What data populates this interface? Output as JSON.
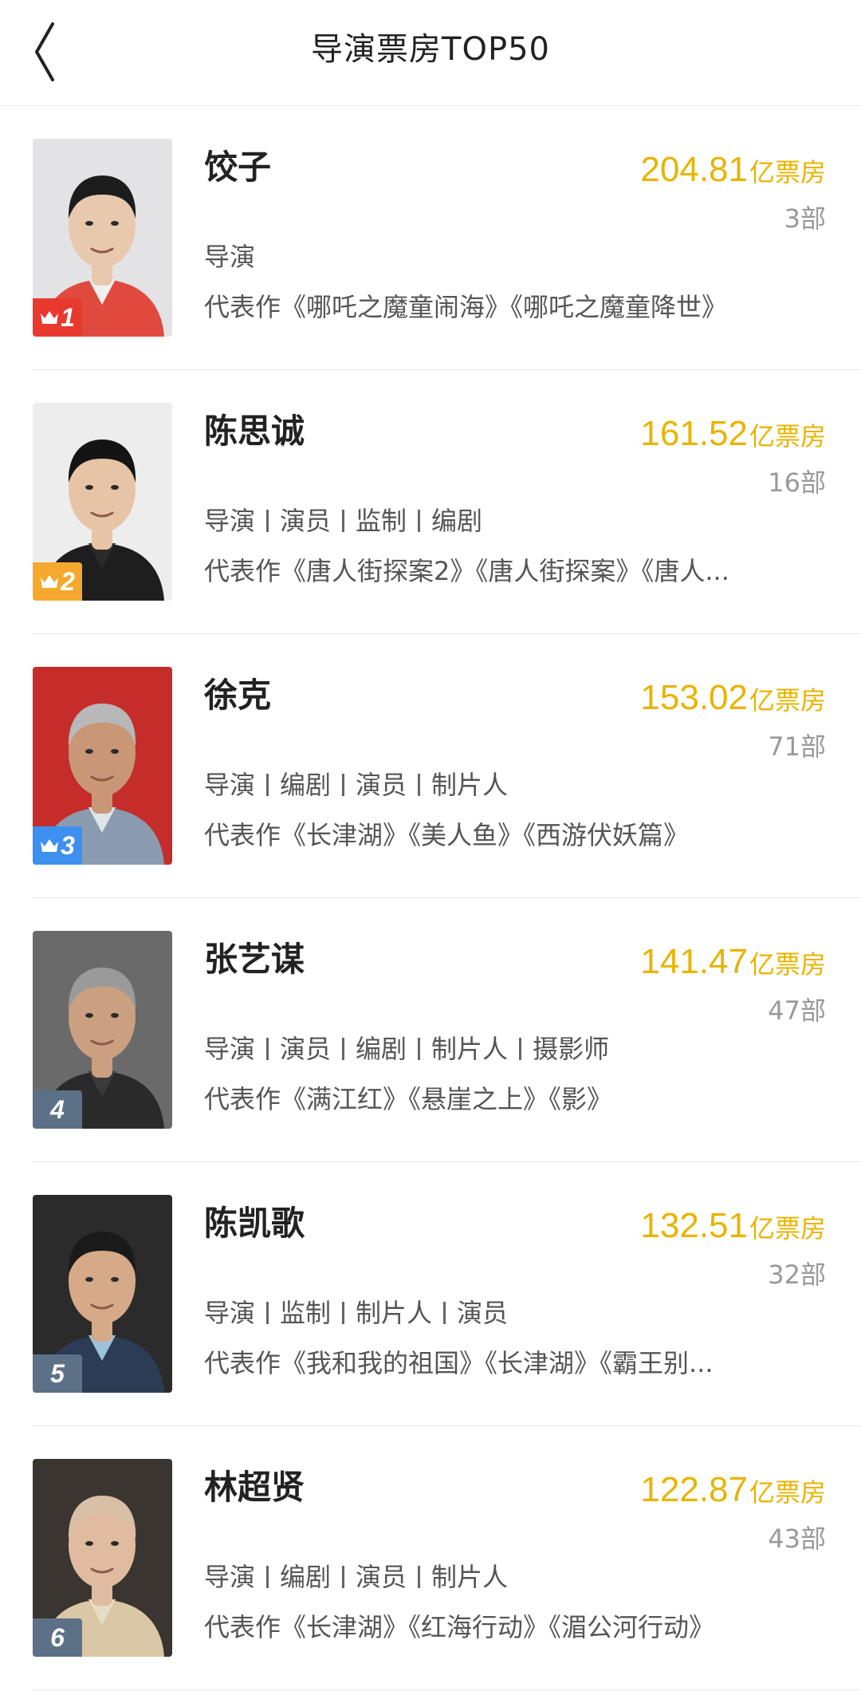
{
  "header": {
    "title": "导演票房TOP50",
    "back_icon": "chevron-left-icon"
  },
  "colors": {
    "accent_gold": "#e8b400",
    "rank1": "#e8392f",
    "rank2": "#f4a92e",
    "rank3": "#3d8ff0",
    "rank_other": "#5c7088"
  },
  "box_unit": "亿票房",
  "works_prefix": "代表作",
  "directors": [
    {
      "rank": "1",
      "name": "饺子",
      "box_office": "204.81",
      "count": "3部",
      "roles": [
        "导演"
      ],
      "works": "《哪吒之魔童闹海》《哪吒之魔童降世》"
    },
    {
      "rank": "2",
      "name": "陈思诚",
      "box_office": "161.52",
      "count": "16部",
      "roles": [
        "导演",
        "演员",
        "监制",
        "编剧"
      ],
      "works": "《唐人街探案2》《唐人街探案》《唐人..."
    },
    {
      "rank": "3",
      "name": "徐克",
      "box_office": "153.02",
      "count": "71部",
      "roles": [
        "导演",
        "编剧",
        "演员",
        "制片人"
      ],
      "works": "《长津湖》《美人鱼》《西游伏妖篇》"
    },
    {
      "rank": "4",
      "name": "张艺谋",
      "box_office": "141.47",
      "count": "47部",
      "roles": [
        "导演",
        "演员",
        "编剧",
        "制片人",
        "摄影师"
      ],
      "works": "《满江红》《悬崖之上》《影》"
    },
    {
      "rank": "5",
      "name": "陈凯歌",
      "box_office": "132.51",
      "count": "32部",
      "roles": [
        "导演",
        "监制",
        "制片人",
        "演员"
      ],
      "works": "《我和我的祖国》《长津湖》《霸王别..."
    },
    {
      "rank": "6",
      "name": "林超贤",
      "box_office": "122.87",
      "count": "43部",
      "roles": [
        "导演",
        "编剧",
        "演员",
        "制片人"
      ],
      "works": "《长津湖》《红海行动》《湄公河行动》"
    }
  ]
}
